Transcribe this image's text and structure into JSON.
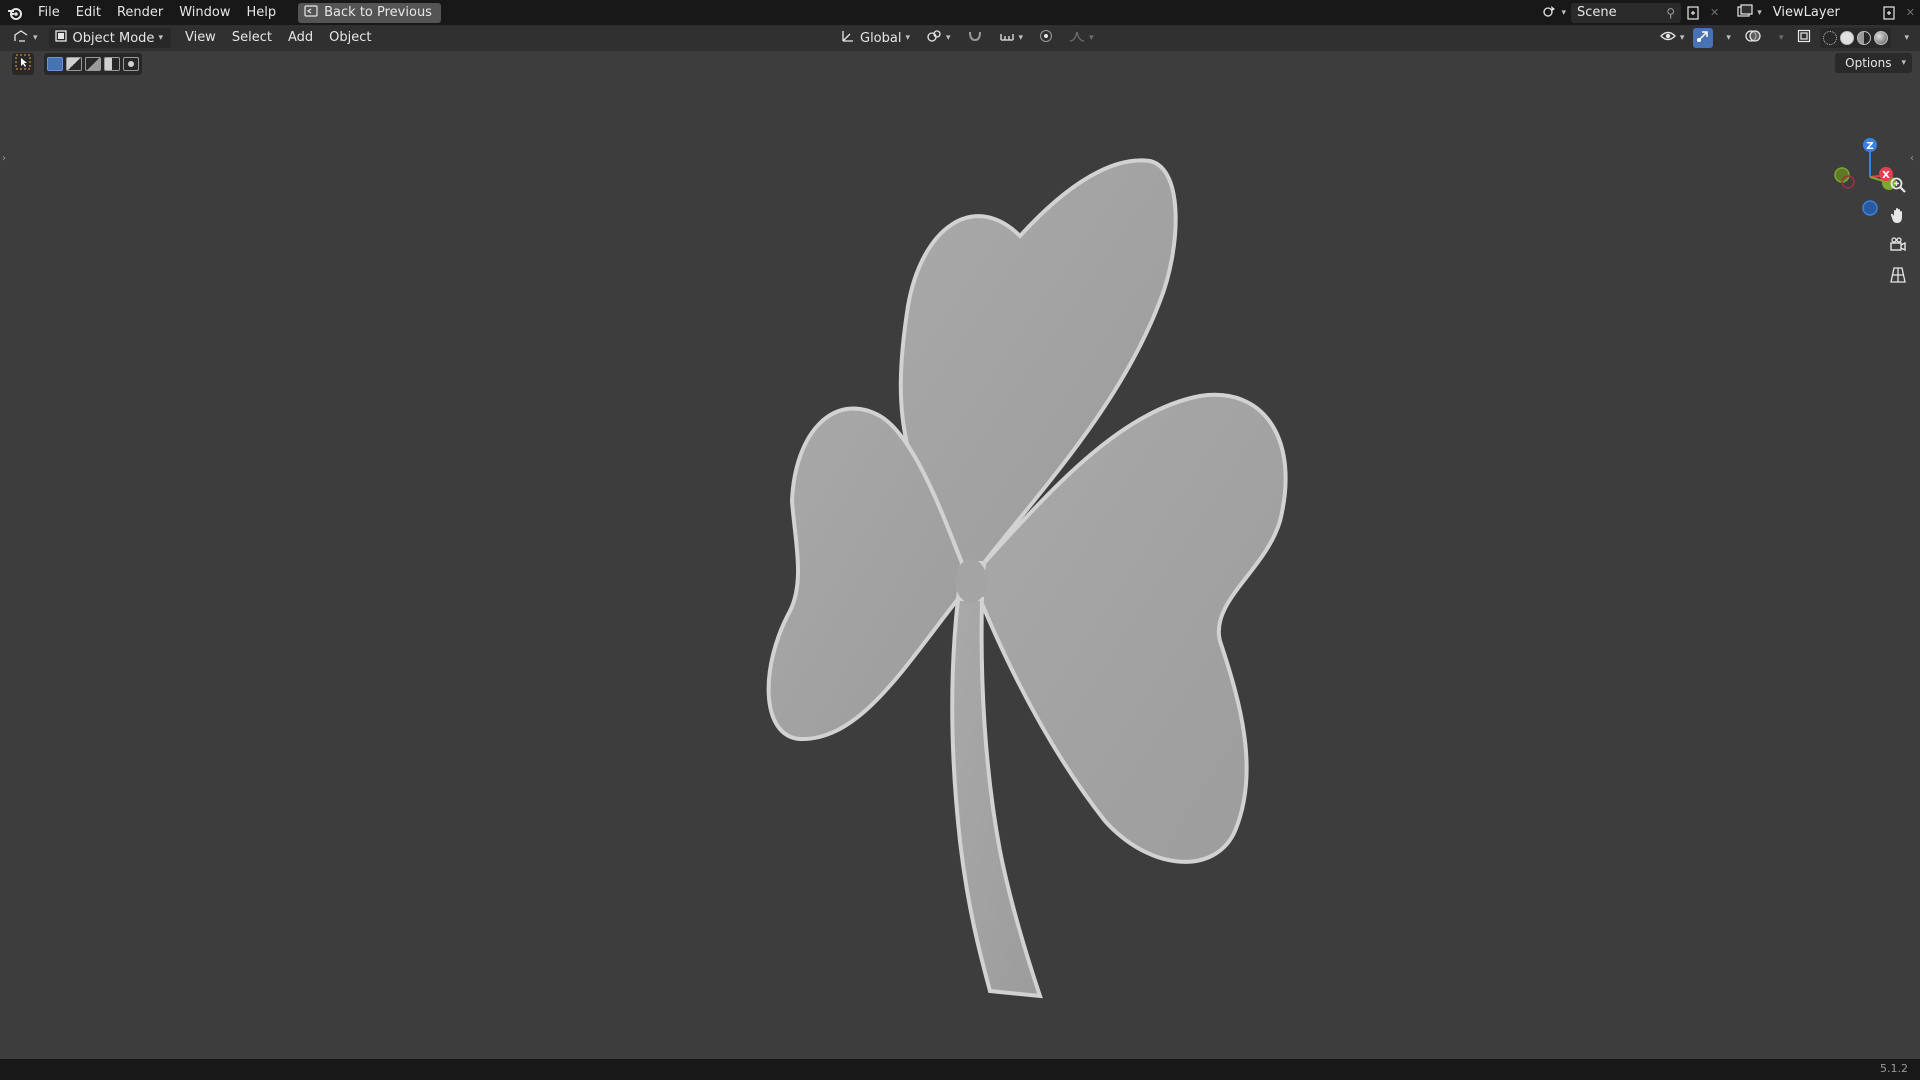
{
  "topbar": {
    "menu": [
      {
        "label": "File"
      },
      {
        "label": "Edit"
      },
      {
        "label": "Render"
      },
      {
        "label": "Window"
      },
      {
        "label": "Help"
      }
    ],
    "back_button": "Back to Previous",
    "scene_name": "Scene",
    "view_layer_name": "ViewLayer"
  },
  "header": {
    "mode": "Object Mode",
    "menu": [
      {
        "label": "View"
      },
      {
        "label": "Select"
      },
      {
        "label": "Add"
      },
      {
        "label": "Object"
      }
    ],
    "transform_orientation": "Global"
  },
  "viewport": {
    "options_label": "Options",
    "gizmo_axes": {
      "z": "Z",
      "x": "X"
    }
  },
  "colors": {
    "axis_x": "#e83d55",
    "axis_y": "#7ea72d",
    "axis_z": "#3b82e0",
    "accent": "#4772b3",
    "object": "#a6a6a6"
  },
  "icons": [
    "blender-logo-icon",
    "back-icon",
    "scene-icon",
    "pin-icon",
    "viewlayer-icon",
    "editor-type-icon",
    "object-mode-icon",
    "orientation-icon",
    "pivot-icon",
    "snap-icon",
    "proportional-icon",
    "visibility-icon",
    "gizmo-icon",
    "overlay-icon",
    "xray-icon",
    "zoom-icon",
    "hand-icon",
    "camera-icon",
    "grid-icon",
    "select-tool-icon"
  ],
  "statusbar": {
    "version": "5.1.2"
  }
}
